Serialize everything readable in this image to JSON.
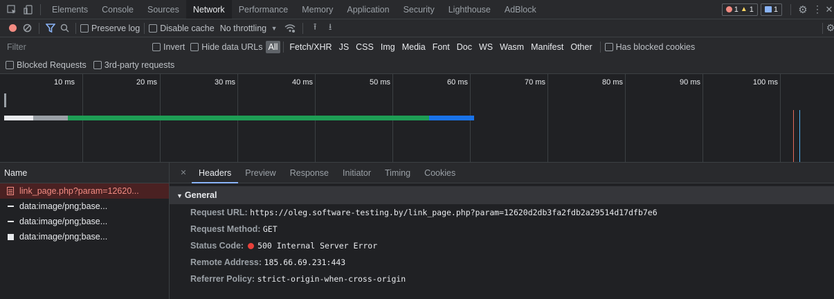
{
  "tabs": [
    "Elements",
    "Console",
    "Sources",
    "Network",
    "Performance",
    "Memory",
    "Application",
    "Security",
    "Lighthouse",
    "AdBlock"
  ],
  "badges": {
    "errors": "1",
    "warnings": "1",
    "messages": "1"
  },
  "toolbar": {
    "preserve_log": "Preserve log",
    "disable_cache": "Disable cache",
    "throttling": "No throttling"
  },
  "filter": {
    "placeholder": "Filter",
    "invert": "Invert",
    "hide_data_urls": "Hide data URLs",
    "types": [
      "All",
      "Fetch/XHR",
      "JS",
      "CSS",
      "Img",
      "Media",
      "Font",
      "Doc",
      "WS",
      "Wasm",
      "Manifest",
      "Other"
    ],
    "has_blocked_cookies": "Has blocked cookies",
    "blocked_requests": "Blocked Requests",
    "third_party": "3rd-party requests"
  },
  "overview": {
    "ticks": [
      "10 ms",
      "20 ms",
      "30 ms",
      "40 ms",
      "50 ms",
      "60 ms",
      "70 ms",
      "80 ms",
      "90 ms",
      "100 ms"
    ]
  },
  "requests": {
    "header": "Name",
    "items": [
      "link_page.php?param=12620...",
      "data:image/png;base...",
      "data:image/png;base...",
      "data:image/png;base..."
    ]
  },
  "detail": {
    "tabs": [
      "Headers",
      "Preview",
      "Response",
      "Initiator",
      "Timing",
      "Cookies"
    ],
    "section": "General",
    "fields": [
      {
        "key": "Request URL:",
        "value": "https://oleg.software-testing.by/link_page.php?param=12620d2db3fa2fdb2a29514d17dfb7e6"
      },
      {
        "key": "Request Method:",
        "value": "GET"
      },
      {
        "key": "Status Code:",
        "value": "500 Internal Server Error"
      },
      {
        "key": "Remote Address:",
        "value": "185.66.69.231:443"
      },
      {
        "key": "Referrer Policy:",
        "value": "strict-origin-when-cross-origin"
      }
    ]
  },
  "colors": {
    "accent": "#8ab4f8",
    "error": "#f28b82",
    "record": "#f28b82",
    "bar_green": "#1e9e55",
    "bar_blue": "#1a73e8"
  }
}
